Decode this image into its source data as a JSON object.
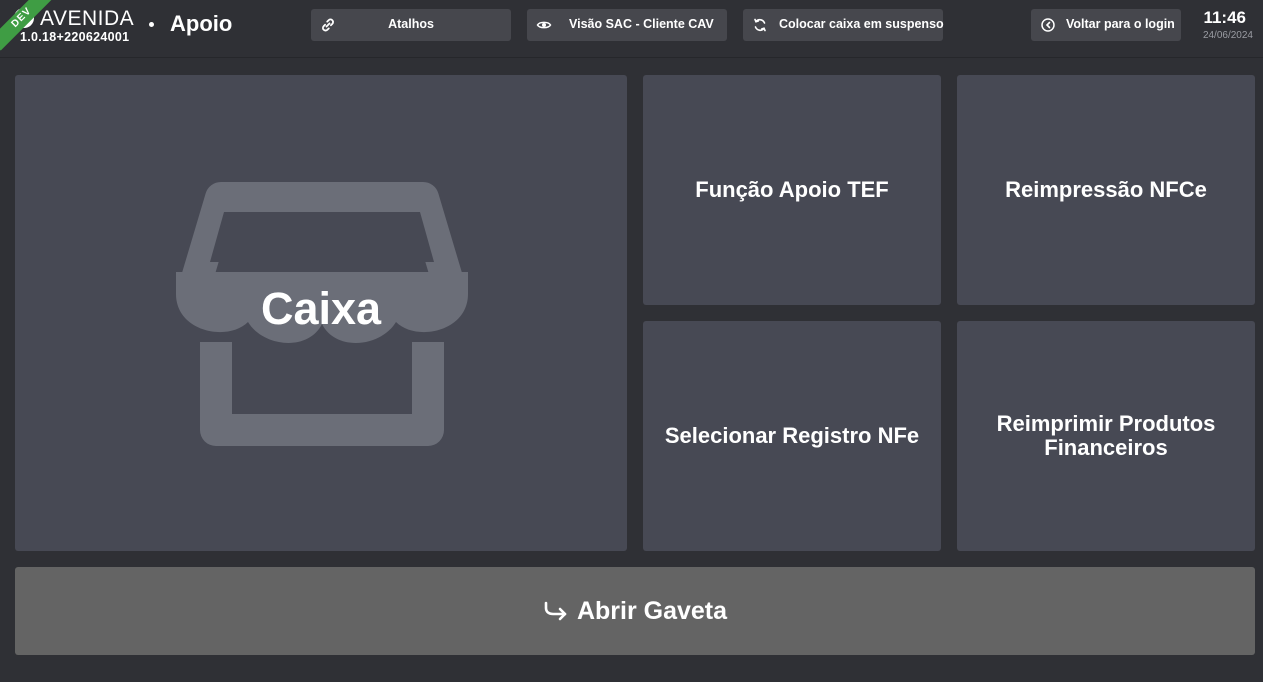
{
  "header": {
    "brand": "AVENIDA",
    "version": "1.0.18+220624001",
    "env_badge": "DEV",
    "page_title": "Apoio",
    "buttons": {
      "shortcuts": {
        "label": "Atalhos",
        "icon": "link-icon"
      },
      "sac_view": {
        "label": "Visão SAC - Cliente CAV",
        "icon": "eye-icon"
      },
      "suspend": {
        "label": "Colocar caixa em suspenso",
        "icon": "refresh-icon"
      },
      "back_login": {
        "label": "Voltar para o login",
        "icon": "arrow-circle-left-icon"
      }
    },
    "time": "11:46",
    "date": "24/06/2024"
  },
  "tiles": {
    "caixa": {
      "label": "Caixa",
      "icon": "store-icon"
    },
    "apoio_tef": {
      "label": "Função Apoio TEF"
    },
    "reimpressao_nfce": {
      "label": "Reimpressão NFCe"
    },
    "selecionar_registro": {
      "label": "Selecionar Registro NFe"
    },
    "reimprimir_produtos": {
      "label": "Reimprimir Produtos Financeiros"
    }
  },
  "drawer": {
    "label": "Abrir Gaveta",
    "icon": "arrow-return-icon"
  },
  "colors": {
    "background": "#2f3035",
    "tile": "#474954",
    "header_button": "#46474d",
    "drawer_button": "#646464",
    "dev_badge": "#3f9d44",
    "icon_muted": "#6b6e78"
  }
}
